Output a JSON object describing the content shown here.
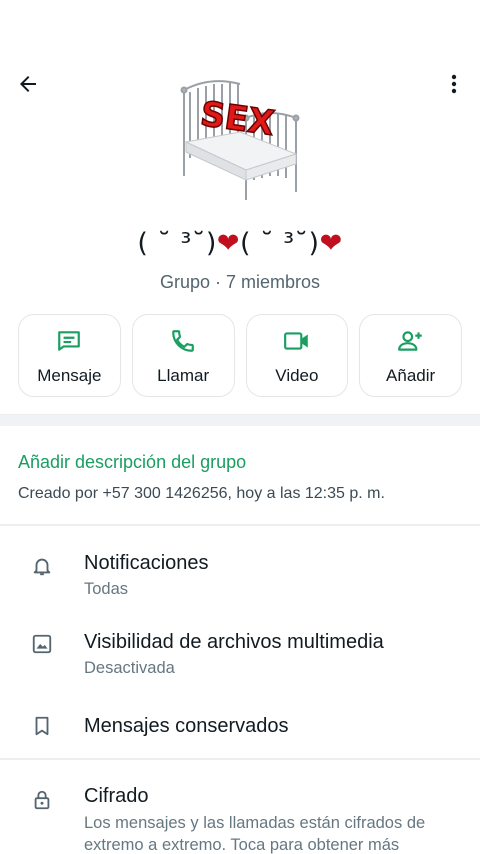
{
  "header": {
    "group_name": "( ˘ ³˘)",
    "group_name_2": "( ˘ ³˘)",
    "heart": "❤",
    "subtitle": "Grupo · 7 miembros",
    "photo_text": "SEX"
  },
  "actions": [
    {
      "label": "Mensaje",
      "icon": "message-icon"
    },
    {
      "label": "Llamar",
      "icon": "phone-icon"
    },
    {
      "label": "Video",
      "icon": "video-icon"
    },
    {
      "label": "Añadir",
      "icon": "add-person-icon"
    }
  ],
  "description": {
    "add_label": "Añadir descripción del grupo",
    "created_text": "Creado por +57 300 1426256, hoy a las 12:35 p. m."
  },
  "settings": {
    "notifications": {
      "title": "Notificaciones",
      "subtitle": "Todas"
    },
    "media": {
      "title": "Visibilidad de archivos multimedia",
      "subtitle": "Desactivada"
    },
    "kept": {
      "title": "Mensajes conservados"
    },
    "encryption": {
      "title": "Cifrado",
      "subtitle": "Los mensajes y las llamadas están cifrados de extremo a extremo. Toca para obtener más"
    }
  },
  "colors": {
    "accent": "#1a9e62",
    "heart": "#c01020"
  }
}
